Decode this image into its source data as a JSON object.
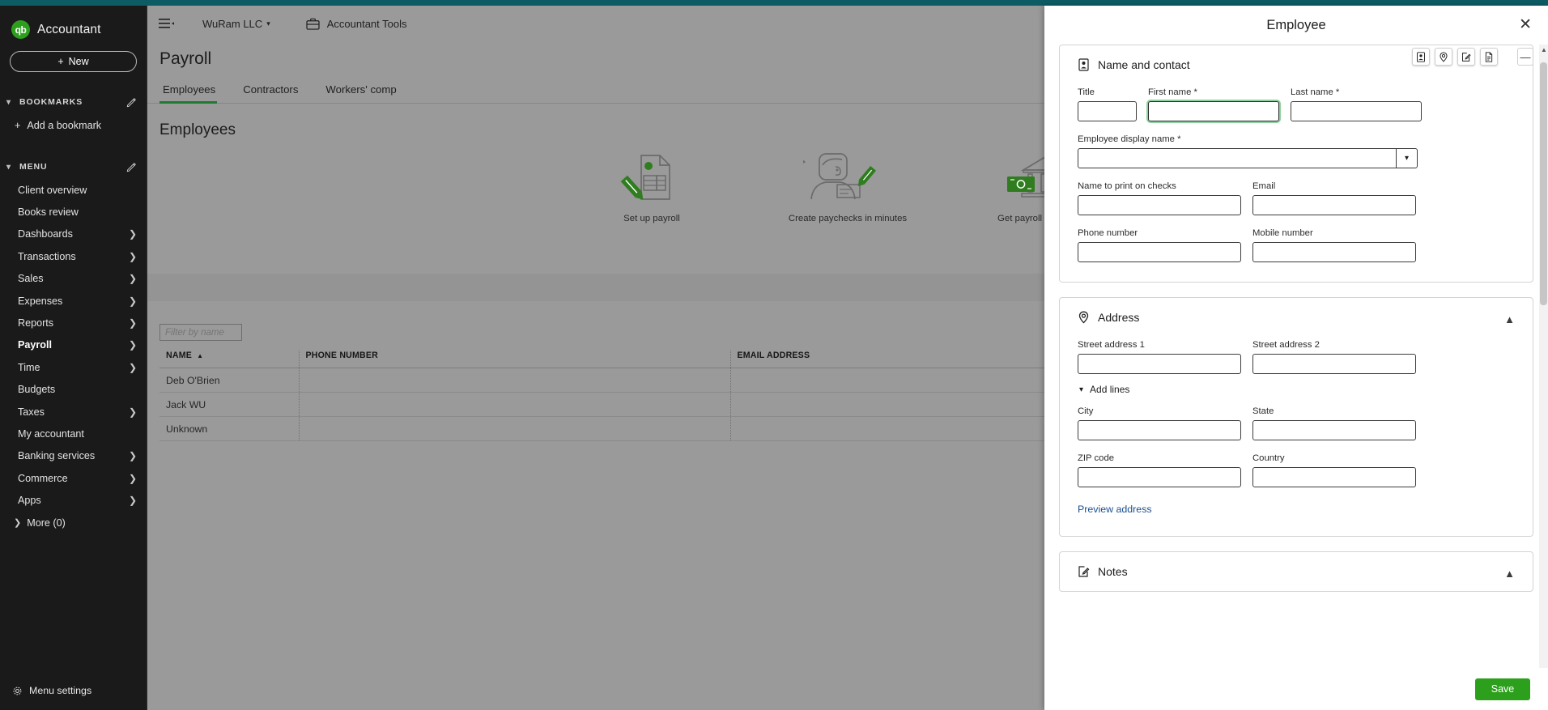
{
  "brand": {
    "name": "Accountant",
    "logo_text": "qb",
    "accent": "#2ca01c"
  },
  "sidebar": {
    "new_button": "New",
    "bookmarks_group": "BOOKMARKS",
    "add_bookmark": "Add a bookmark",
    "menu_group": "MENU",
    "items": [
      {
        "label": "Client overview",
        "chevron": false,
        "active": false
      },
      {
        "label": "Books review",
        "chevron": false,
        "active": false
      },
      {
        "label": "Dashboards",
        "chevron": true,
        "active": false
      },
      {
        "label": "Transactions",
        "chevron": true,
        "active": false
      },
      {
        "label": "Sales",
        "chevron": true,
        "active": false
      },
      {
        "label": "Expenses",
        "chevron": true,
        "active": false
      },
      {
        "label": "Reports",
        "chevron": true,
        "active": false
      },
      {
        "label": "Payroll",
        "chevron": true,
        "active": true
      },
      {
        "label": "Time",
        "chevron": true,
        "active": false
      },
      {
        "label": "Budgets",
        "chevron": false,
        "active": false
      },
      {
        "label": "Taxes",
        "chevron": true,
        "active": false
      },
      {
        "label": "My accountant",
        "chevron": false,
        "active": false
      },
      {
        "label": "Banking services",
        "chevron": true,
        "active": false
      },
      {
        "label": "Commerce",
        "chevron": true,
        "active": false
      },
      {
        "label": "Apps",
        "chevron": true,
        "active": false
      }
    ],
    "more_label": "More (0)",
    "menu_settings": "Menu settings"
  },
  "topbar": {
    "company": "WuRam LLC",
    "accountant_tools": "Accountant Tools"
  },
  "main": {
    "page_title": "Payroll",
    "tabs": [
      {
        "label": "Employees",
        "active": true
      },
      {
        "label": "Contractors",
        "active": false
      },
      {
        "label": "Workers' comp",
        "active": false
      }
    ],
    "section_title": "Employees",
    "illustrations": [
      {
        "caption": "Set up payroll"
      },
      {
        "caption": "Create paychecks in minutes"
      },
      {
        "caption": "Get payroll taxes done"
      }
    ],
    "filter_placeholder": "Filter by name",
    "table": {
      "columns": [
        "NAME",
        "PHONE NUMBER",
        "EMAIL ADDRESS"
      ],
      "sort_column": "NAME",
      "sort_direction": "asc",
      "rows": [
        {
          "name": "Deb O'Brien",
          "phone": "",
          "email": ""
        },
        {
          "name": "Jack WU",
          "phone": "",
          "email": ""
        },
        {
          "name": "Unknown",
          "phone": "",
          "email": ""
        }
      ]
    }
  },
  "panel": {
    "title": "Employee",
    "close_label": "✕",
    "shortcut_icons": [
      "contact-card-icon",
      "location-pin-icon",
      "edit-note-icon",
      "document-icon"
    ],
    "minimize_label": "—",
    "save_label": "Save",
    "name_contact": {
      "section_title": "Name and contact",
      "title_label": "Title",
      "title_value": "",
      "first_name_label": "First name *",
      "first_name_value": "",
      "last_name_label": "Last name *",
      "last_name_value": "",
      "display_name_label": "Employee display name *",
      "display_name_value": "",
      "print_name_label": "Name to print on checks",
      "print_name_value": "",
      "email_label": "Email",
      "email_value": "",
      "phone_label": "Phone number",
      "phone_value": "",
      "mobile_label": "Mobile number",
      "mobile_value": ""
    },
    "address": {
      "section_title": "Address",
      "street1_label": "Street address 1",
      "street1_value": "",
      "street2_label": "Street address 2",
      "street2_value": "",
      "add_lines_label": "Add lines",
      "city_label": "City",
      "city_value": "",
      "state_label": "State",
      "state_value": "",
      "zip_label": "ZIP code",
      "zip_value": "",
      "country_label": "Country",
      "country_value": "",
      "preview_label": "Preview address"
    },
    "notes": {
      "section_title": "Notes"
    }
  }
}
